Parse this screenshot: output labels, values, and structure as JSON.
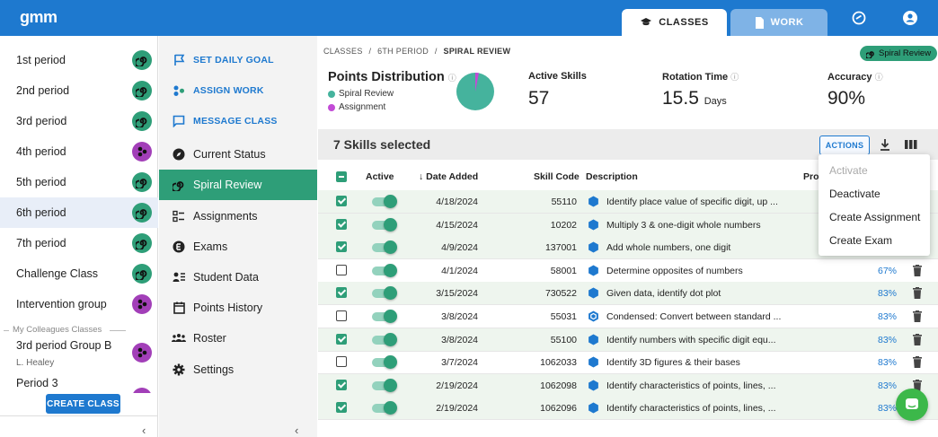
{
  "app": {
    "logo": "gmm"
  },
  "topnav": {
    "tabs": [
      {
        "label": "CLASSES",
        "active": true
      },
      {
        "label": "WORK",
        "active": false
      }
    ]
  },
  "classes": {
    "items": [
      {
        "label": "1st period",
        "icon": "spiral-icon",
        "color": "#2e9e78"
      },
      {
        "label": "2nd period",
        "icon": "spiral-icon",
        "color": "#2e9e78"
      },
      {
        "label": "3rd period",
        "icon": "spiral-icon",
        "color": "#2e9e78"
      },
      {
        "label": "4th period",
        "icon": "group-icon",
        "color": "#a23fb8"
      },
      {
        "label": "5th period",
        "icon": "spiral-icon",
        "color": "#2e9e78"
      },
      {
        "label": "6th period",
        "icon": "spiral-icon",
        "color": "#2e9e78",
        "selected": true
      },
      {
        "label": "7th period",
        "icon": "spiral-icon",
        "color": "#2e9e78"
      },
      {
        "label": "Challenge Class",
        "icon": "spiral-icon",
        "color": "#2e9e78"
      },
      {
        "label": "Intervention group",
        "icon": "group-icon",
        "color": "#a23fb8"
      }
    ],
    "colleagues_label": "My Colleagues Classes",
    "colleague_items": [
      {
        "label": "3rd period Group B",
        "teacher": "L. Healey"
      },
      {
        "label": "Period 3"
      }
    ],
    "create_button": "CREATE CLASS"
  },
  "nav": {
    "actions": [
      "SET DAILY GOAL",
      "ASSIGN WORK",
      "MESSAGE CLASS"
    ],
    "items": [
      "Current Status",
      "Spiral Review",
      "Assignments",
      "Exams",
      "Student Data",
      "Points History",
      "Roster",
      "Settings"
    ],
    "selected": "Spiral Review"
  },
  "breadcrumb": {
    "parts": [
      "CLASSES",
      "6TH PERIOD",
      "SPIRAL REVIEW"
    ],
    "separator": "/"
  },
  "badge": "Spiral Review",
  "points": {
    "title": "Points Distribution",
    "legend": [
      {
        "label": "Spiral Review",
        "color": "#45b39d"
      },
      {
        "label": "Assignment",
        "color": "#c24bd6"
      }
    ]
  },
  "stats": {
    "active_skills": {
      "label": "Active Skills",
      "value": "57"
    },
    "rotation_time": {
      "label": "Rotation Time",
      "value": "15.5",
      "unit": "Days"
    },
    "accuracy": {
      "label": "Accuracy",
      "value": "90%"
    }
  },
  "selection": {
    "text": "7 Skills selected",
    "actions_label": "ACTIONS"
  },
  "table": {
    "headers": {
      "active": "Active",
      "date": "Date Added",
      "code": "Skill Code",
      "desc": "Description",
      "prof": "Pro"
    },
    "rows": [
      {
        "checked": true,
        "date": "4/18/2024",
        "code": "55110",
        "desc": "Identify place value of specific digit, up ...",
        "pct": ""
      },
      {
        "checked": true,
        "date": "4/15/2024",
        "code": "10202",
        "desc": "Multiply 3 & one-digit whole numbers",
        "pct": ""
      },
      {
        "checked": true,
        "date": "4/9/2024",
        "code": "137001",
        "desc": "Add whole numbers, one digit",
        "pct": ""
      },
      {
        "checked": false,
        "date": "4/1/2024",
        "code": "58001",
        "desc": "Determine opposites of numbers",
        "pct": "67%"
      },
      {
        "checked": true,
        "date": "3/15/2024",
        "code": "730522",
        "desc": "Given data, identify dot plot",
        "pct": "83%"
      },
      {
        "checked": false,
        "date": "3/8/2024",
        "code": "55031",
        "desc": "Condensed: Convert between standard ...",
        "pct": "83%",
        "hex_outline": true
      },
      {
        "checked": true,
        "date": "3/8/2024",
        "code": "55100",
        "desc": "Identify numbers with specific digit equ...",
        "pct": "83%"
      },
      {
        "checked": false,
        "date": "3/7/2024",
        "code": "1062033",
        "desc": "Identify 3D figures & their bases",
        "pct": "83%"
      },
      {
        "checked": true,
        "date": "2/19/2024",
        "code": "1062098",
        "desc": "Identify characteristics of points, lines, ...",
        "pct": "83%"
      },
      {
        "checked": true,
        "date": "2/19/2024",
        "code": "1062096",
        "desc": "Identify characteristics of points, lines, ...",
        "pct": "83%"
      }
    ]
  },
  "actions_menu": [
    {
      "label": "Activate",
      "disabled": true
    },
    {
      "label": "Deactivate"
    },
    {
      "label": "Create Assignment"
    },
    {
      "label": "Create Exam"
    }
  ],
  "colors": {
    "brand": "#1e79cf",
    "green": "#2e9e78",
    "purple": "#a23fb8"
  }
}
